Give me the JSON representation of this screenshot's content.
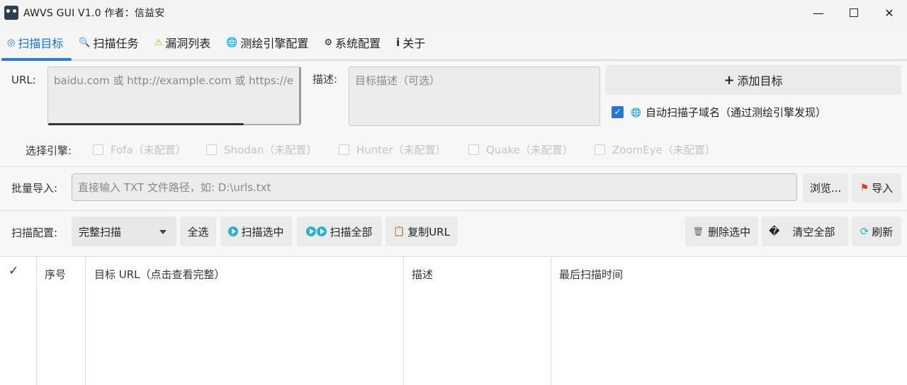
{
  "window": {
    "title": "AWVS GUI  V1.0  作者：信益安",
    "minimize": "—",
    "close": "✕"
  },
  "tabs": [
    {
      "icon": "◎",
      "label": "扫描目标"
    },
    {
      "icon": "🔍",
      "label": "扫描任务"
    },
    {
      "icon": "⚠",
      "label": "漏洞列表"
    },
    {
      "icon": "🌐",
      "label": "测绘引擎配置"
    },
    {
      "icon": "⚙",
      "label": "系统配置"
    },
    {
      "icon": "i",
      "label": "关于"
    }
  ],
  "target": {
    "url_label": "URL:",
    "url_placeholder": "baidu.com 或  http://example.com 或  https://e",
    "desc_label": "描述:",
    "desc_placeholder": "目标描述（可选）",
    "add_button": "添加目标",
    "auto_subdomain": "自动扫描子域名（通过测绘引擎发现）"
  },
  "engines": {
    "label": "选择引擎:",
    "items": [
      "Fofa（未配置）",
      "Shodan（未配置）",
      "Hunter（未配置）",
      "Quake（未配置）",
      "ZoomEye（未配置）"
    ]
  },
  "batch": {
    "label": "批量导入:",
    "placeholder": "直接输入 TXT 文件路径，如: D:\\urls.txt",
    "browse": "浏览...",
    "import": "导入"
  },
  "scan_config": {
    "label": "扫描配置:",
    "selected": "完整扫描",
    "select_all": "全选",
    "scan_selected": "扫描选中",
    "scan_all": "扫描全部",
    "copy_url": "复制URL",
    "delete_selected": "删除选中",
    "clear_icon": "�",
    "clear_all": "清空全部",
    "refresh": "刷新"
  },
  "table": {
    "columns": [
      "✓",
      "序号",
      "目标 URL（点击查看完整）",
      "描述",
      "最后扫描时间"
    ]
  }
}
